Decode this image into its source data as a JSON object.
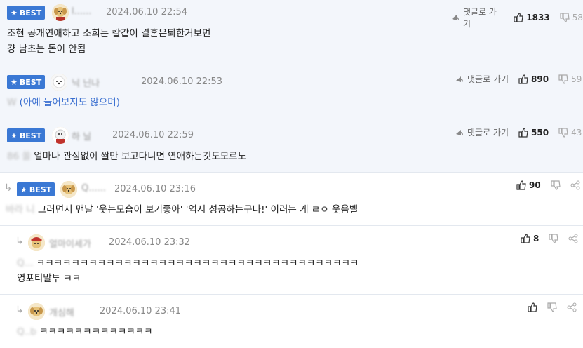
{
  "best_label": "BEST",
  "reply_label": "댓글로 가기",
  "comments": [
    {
      "nick": "l......",
      "date": "2024.06.10 22:54",
      "lines": [
        "조현 공개연애하고 소희는 칼같이 결혼은퇴한거보면",
        "걍 남초는 돈이 안됨"
      ],
      "likes": "1833",
      "dislikes": "58"
    },
    {
      "nick": "닉      닌나",
      "date": "2024.06.10 22:53",
      "prefix": "W   ",
      "line": "(아예 들어보지도 않으며)",
      "likes": "890",
      "dislikes": "59"
    },
    {
      "nick": "하    닐",
      "date": "2024.06.10 22:59",
      "prefix": "86      쏠",
      "line": "얼마나 관심없이 짤만 보고다니면 연애하는것도모르노",
      "likes": "550",
      "dislikes": "43"
    },
    {
      "nick": "Q......",
      "date": "2024.06.10 23:16",
      "prefix": "바라    니",
      "line": "그러면서 맨날 '웃는모습이 보기좋아' '역시 성공하는구나!' 이러는 게 ㄹㅇ 웃음벨",
      "likes": "90"
    },
    {
      "nick": "얼마이세가",
      "date": "2024.06.10 23:32",
      "prefix": "Q...",
      "lines": [
        "ㅋㅋㅋㅋㅋㅋㅋㅋㅋㅋㅋㅋㅋㅋㅋㅋㅋㅋㅋㅋㅋㅋㅋㅋㅋㅋㅋㅋㅋㅋㅋㅋㅋㅋㅋㅋㅋ",
        "영포티말투 ㅋㅋ"
      ],
      "likes": "8"
    },
    {
      "nick": "개심해",
      "date": "2024.06.10 23:41",
      "prefix": "Q..b",
      "line": "ㅋㅋㅋㅋㅋㅋㅋㅋㅋㅋㅋㅋㅋ"
    }
  ],
  "colors": {
    "badge": "#3a78d4",
    "best_bg": "#f3f6fb",
    "link": "#3a6fd0"
  }
}
